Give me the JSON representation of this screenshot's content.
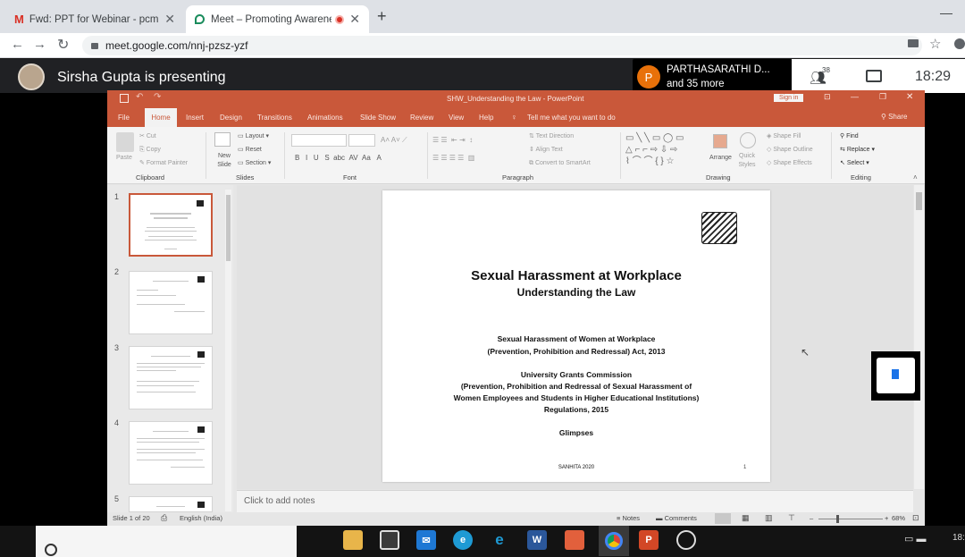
{
  "browser": {
    "tabs": [
      {
        "title": "Fwd: PPT for Webinar - pcmm.wb",
        "icon": "gmail-icon"
      },
      {
        "title": "Meet – Promoting Awarenes",
        "icon": "meet-icon",
        "recording": true
      }
    ],
    "url": "meet.google.com/nnj-pzsz-yzf",
    "new_tab_label": "+"
  },
  "meet": {
    "presenting_text": "Sirsha Gupta is presenting",
    "participant_initial": "P",
    "participant_name": "PARTHASARATHI D...",
    "participant_more": "and 35 more",
    "people_count": "38",
    "time": "18:29"
  },
  "powerpoint": {
    "window_title": "SHW_Understanding the Law  -  PowerPoint",
    "sign_in": "Sign in",
    "share": "Share",
    "ribbon_tabs": [
      "File",
      "Home",
      "Insert",
      "Design",
      "Transitions",
      "Animations",
      "Slide Show",
      "Review",
      "View",
      "Help",
      "Tell me what you want to do"
    ],
    "ribbon": {
      "clipboard": {
        "label": "Clipboard",
        "paste": "Paste",
        "cut": "Cut",
        "copy": "Copy",
        "format_painter": "Format Painter"
      },
      "slides": {
        "label": "Slides",
        "new_slide": "New Slide",
        "layout": "Layout",
        "reset": "Reset",
        "section": "Section"
      },
      "font": {
        "label": "Font"
      },
      "paragraph": {
        "label": "Paragraph",
        "text_direction": "Text Direction",
        "align_text": "Align Text",
        "smartart": "Convert to SmartArt"
      },
      "drawing": {
        "label": "Drawing",
        "arrange": "Arrange",
        "quick_styles": "Quick Styles",
        "shape_fill": "Shape Fill",
        "shape_outline": "Shape Outline",
        "shape_effects": "Shape Effects"
      },
      "editing": {
        "label": "Editing",
        "find": "Find",
        "replace": "Replace",
        "select": "Select"
      }
    },
    "thumbnails": [
      "1",
      "2",
      "3",
      "4",
      "5"
    ],
    "slide": {
      "title": "Sexual Harassment at Workplace",
      "subtitle": "Understanding the Law",
      "act_line1": "Sexual Harassment of Women at Workplace",
      "act_line2": "(Prevention, Prohibition and Redressal) Act, 2013",
      "ugc_line1": "University Grants Commission",
      "ugc_line2": "(Prevention, Prohibition and Redressal of Sexual Harassment of",
      "ugc_line3": "Women Employees and Students in Higher Educational Institutions)",
      "ugc_line4": "Regulations, 2015",
      "glimpses": "Glimpses",
      "footer": "SANHITA 2020",
      "page": "1"
    },
    "notes_placeholder": "Click to add notes",
    "status": {
      "slide_count": "Slide 1 of 20",
      "language": "English (India)",
      "notes": "Notes",
      "comments": "Comments",
      "zoom": "68%"
    }
  },
  "taskbar": {
    "apps": [
      "file-explorer-icon",
      "store-icon",
      "mail-icon",
      "edge-icon",
      "ie-icon",
      "word-icon",
      "paint-icon",
      "chrome-icon",
      "powerpoint-icon",
      "obs-icon"
    ],
    "clock_partial": "18:"
  }
}
